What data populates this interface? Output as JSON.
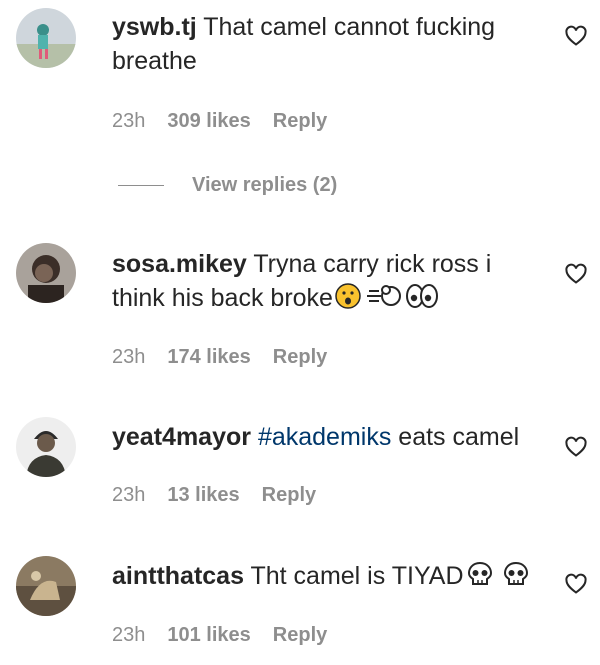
{
  "comments": [
    {
      "username": "yswb.tj",
      "text": "That camel cannot fucking breathe",
      "time": "23h",
      "likes": "309 likes",
      "reply_label": "Reply",
      "view_replies": "View replies (2)"
    },
    {
      "username": "sosa.mikey",
      "text": "Tryna carry rick ross i think his back broke",
      "emojis": [
        "astonished-face",
        "dashing-away",
        "eyes"
      ],
      "time": "23h",
      "likes": "174 likes",
      "reply_label": "Reply"
    },
    {
      "username": "yeat4mayor",
      "hashtag": "#akademiks",
      "text": "eats camel",
      "time": "23h",
      "likes": "13 likes",
      "reply_label": "Reply"
    },
    {
      "username": "aintthatcas",
      "text": "Tht camel is TIYAD",
      "emojis": [
        "skull",
        "skull"
      ],
      "time": "23h",
      "likes": "101 likes",
      "reply_label": "Reply"
    }
  ],
  "colors": {
    "text": "#262626",
    "secondary": "#8e8e8e",
    "hashtag": "#00376b",
    "background": "#ffffff"
  }
}
